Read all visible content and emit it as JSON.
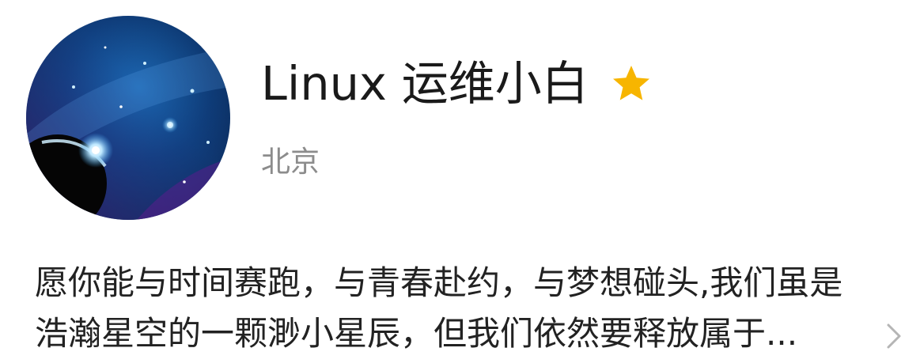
{
  "profile": {
    "nickname": "Linux 运维小白",
    "location": "北京",
    "signature_line1": "愿你能与时间赛跑，与青春赴约，与梦想碰头,我们虽是",
    "signature_line2": "浩瀚星空的一颗渺小星辰，但我们依然要释放属于...",
    "avatar_icon": "galaxy-avatar-icon",
    "badge_icon": "star-icon",
    "chevron_icon": "chevron-right-icon"
  },
  "colors": {
    "star": "#f7b500",
    "name": "#1a1a1a",
    "location": "#8c8c8c",
    "signature": "#222222",
    "chevron": "#b5b5b5"
  }
}
